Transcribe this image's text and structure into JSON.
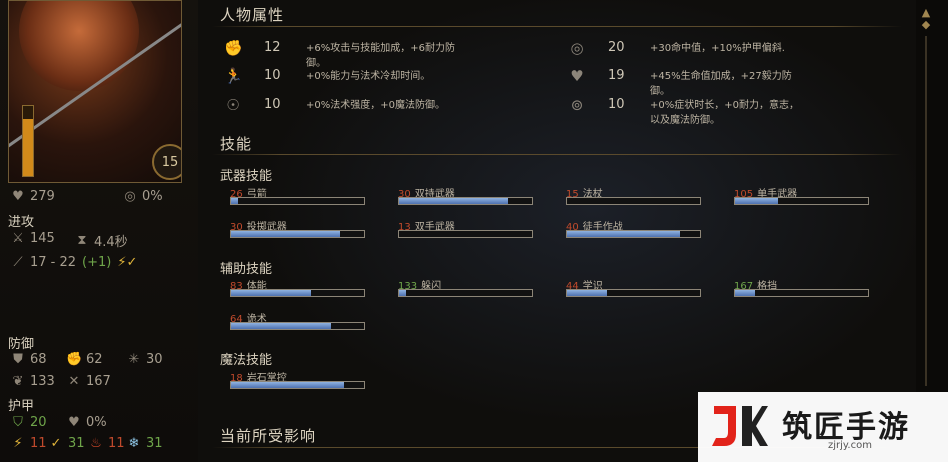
{
  "portrait": {
    "level": "15",
    "hp_fraction": 0.82
  },
  "left_stats": {
    "health": "279",
    "accuracy_pct": "0%",
    "offense_label": "进攻",
    "attack": "145",
    "speed": "4.4秒",
    "damage": "17 - 22",
    "damage_bonus": "(+1)",
    "defense_label": "防御",
    "deflection": "68",
    "fortitude": "62",
    "reflex": "30",
    "will": "133",
    "dmg_reduction": "167",
    "armor_label": "护甲",
    "armor_1": "20",
    "armor_2": "0%",
    "res_1": "11",
    "res_2": "31",
    "res_3": "11",
    "res_4": "31"
  },
  "attributes_title": "人物属性",
  "attributes": [
    {
      "icon": "might-icon",
      "value": "12",
      "desc": "+6%攻击与技能加成，+6耐力防御。"
    },
    {
      "icon": "dexterity-icon",
      "value": "10",
      "desc": "+0%能力与法术冷却时间。"
    },
    {
      "icon": "intellect-icon",
      "value": "10",
      "desc": "+0%法术强度，+0魔法防御。"
    },
    {
      "icon": "perception-icon",
      "value": "20",
      "desc": "+30命中值，+10%护甲偏斜."
    },
    {
      "icon": "constitution-icon",
      "value": "19",
      "desc": "+45%生命值加成，+27毅力防御。"
    },
    {
      "icon": "resolve-icon",
      "value": "10",
      "desc": "+0%症状时长，+0耐力，意志，以及魔法防御。"
    }
  ],
  "skills_title": "技能",
  "weapon_skills_label": "武器技能",
  "weapon_skills": [
    {
      "num": "26",
      "name": "弓箭",
      "fill": 0.05
    },
    {
      "num": "30",
      "name": "双持武器",
      "fill": 0.82
    },
    {
      "num": "15",
      "name": "法杖",
      "fill": 0.0
    },
    {
      "num": "105",
      "name": "单手武器",
      "fill": 0.32
    },
    {
      "num": "30",
      "name": "投掷武器",
      "fill": 0.82
    },
    {
      "num": "13",
      "name": "双手武器",
      "fill": 0.0
    },
    {
      "num": "40",
      "name": "徒手作战",
      "fill": 0.85
    }
  ],
  "support_skills_label": "辅助技能",
  "support_skills": [
    {
      "num": "83",
      "name": "体能",
      "fill": 0.6,
      "green": false
    },
    {
      "num": "133",
      "name": "躲闪",
      "fill": 0.05,
      "green": true
    },
    {
      "num": "44",
      "name": "学识",
      "fill": 0.3,
      "green": false
    },
    {
      "num": "167",
      "name": "格挡",
      "fill": 0.15,
      "green": true
    },
    {
      "num": "64",
      "name": "诡术",
      "fill": 0.75,
      "green": false
    }
  ],
  "magic_skills_label": "魔法技能",
  "magic_skills": [
    {
      "num": "18",
      "name": "岩石掌控",
      "fill": 0.85
    }
  ],
  "effects_title": "当前所受影响",
  "watermark": {
    "brand": "筑匠手游",
    "url": "zjrjy.com"
  }
}
